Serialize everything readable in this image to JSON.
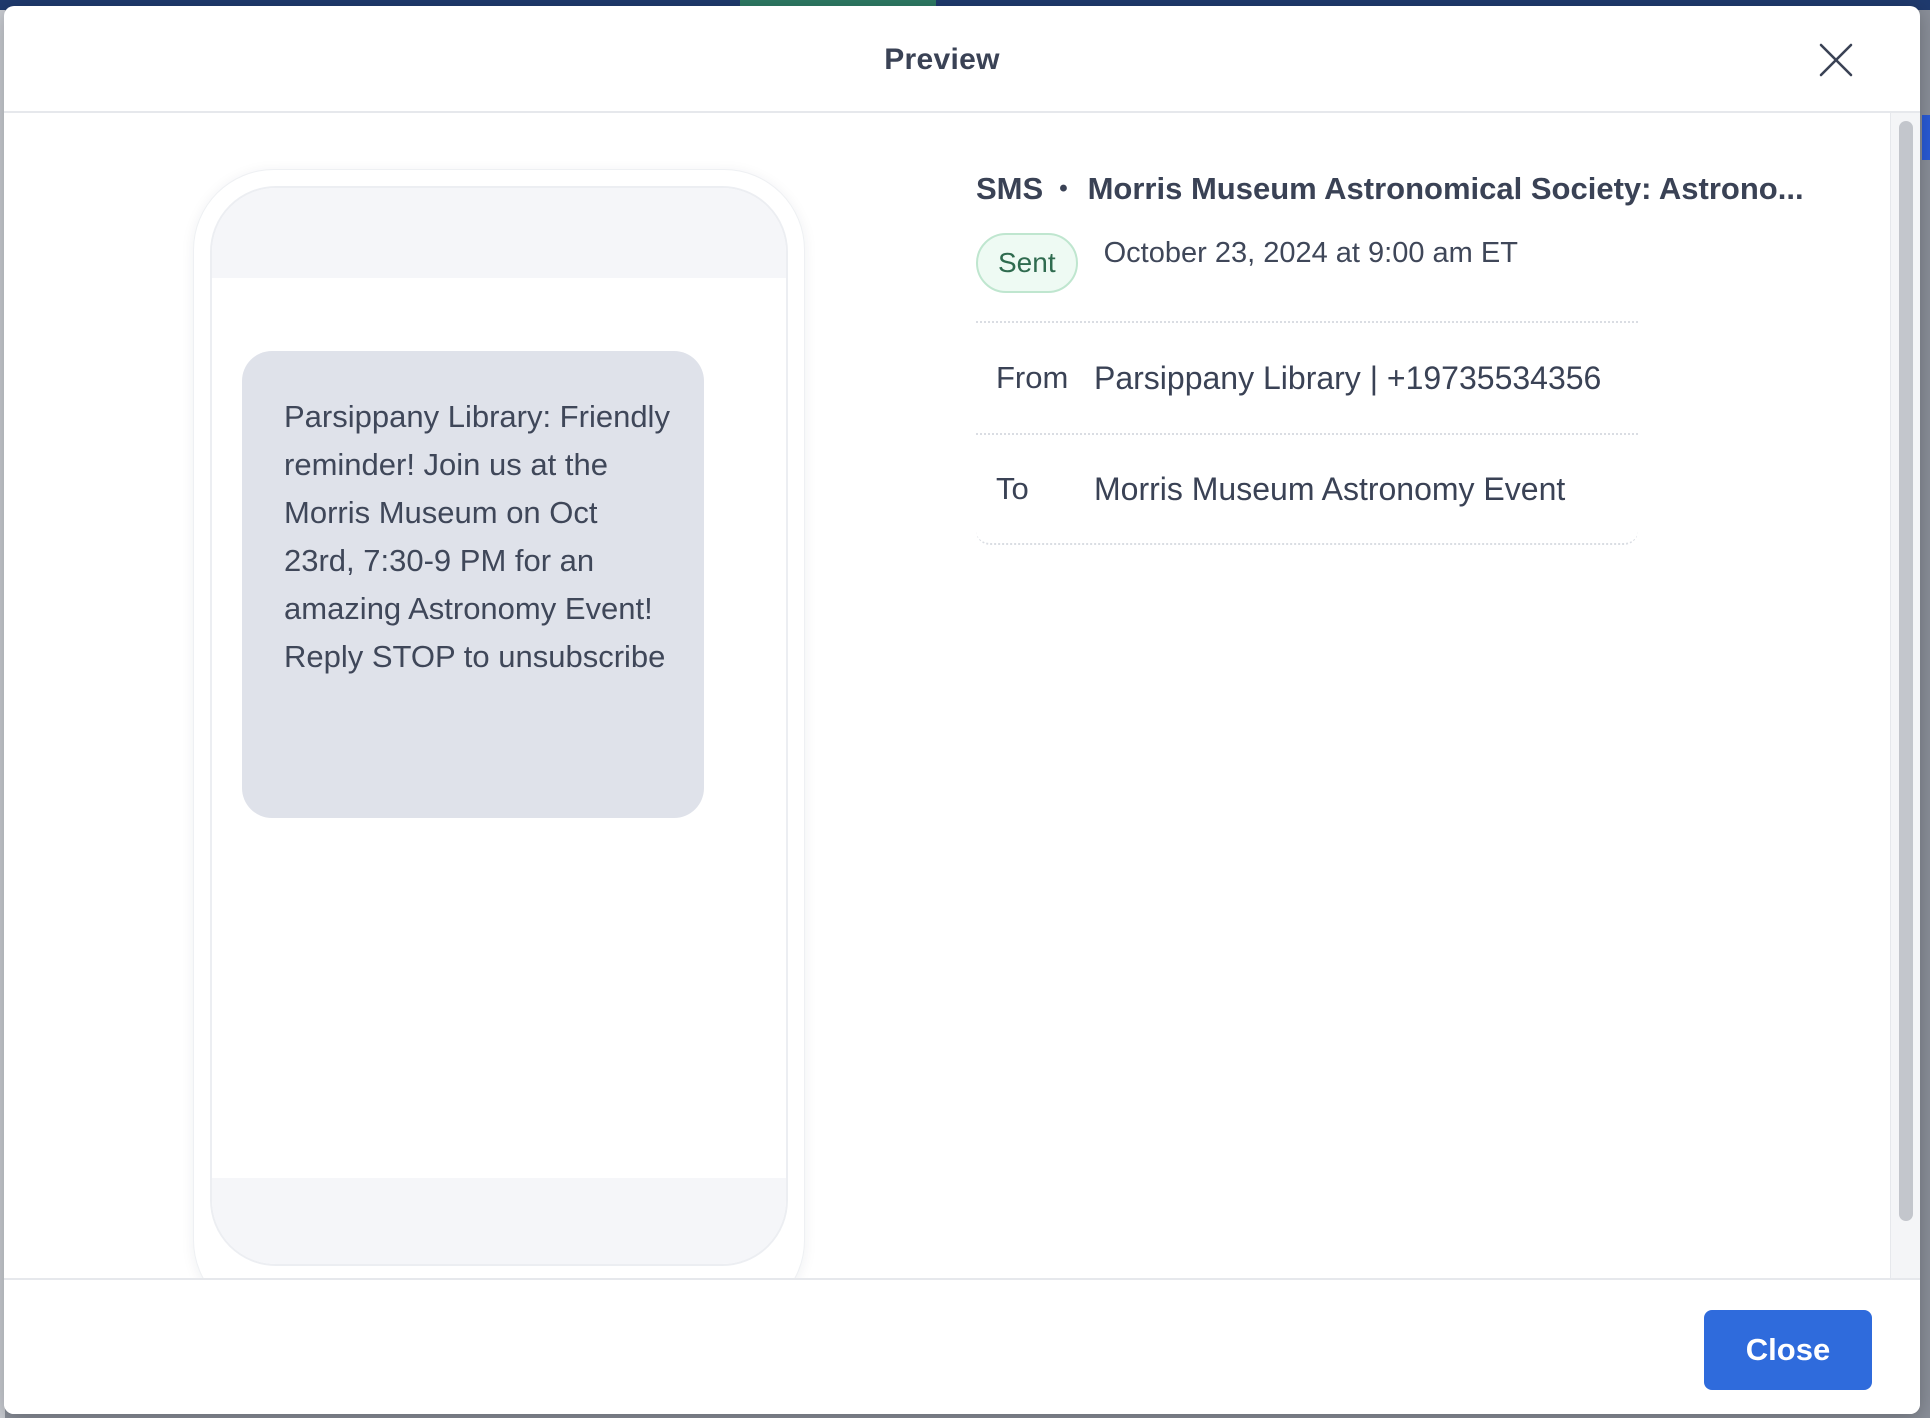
{
  "colors": {
    "primary_button": "#2f6bdc",
    "status_sent_bg": "#eefaf3",
    "status_sent_text": "#2f6b4f",
    "bubble_bg": "#dfe2ea"
  },
  "modal": {
    "title": "Preview",
    "close_icon": "close-icon"
  },
  "preview": {
    "message": "Parsippany Library: Friendly reminder! Join us at the Morris Museum on Oct 23rd, 7:30-9 PM for an amazing Astronomy Event!\nReply STOP to unsubscribe"
  },
  "details": {
    "channel": "SMS",
    "separator": "•",
    "campaign_name": "Morris Museum Astronomical Society: Astrono...",
    "status": "Sent",
    "sent_at": "October 23, 2024 at 9:00 am ET",
    "from_label": "From",
    "from_value": "Parsippany Library | +19735534356",
    "to_label": "To",
    "to_value": "Morris Museum Astronomy Event"
  },
  "footer": {
    "close_label": "Close"
  }
}
